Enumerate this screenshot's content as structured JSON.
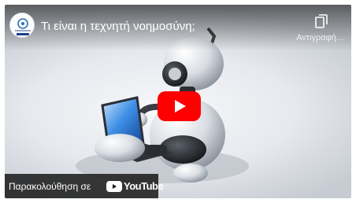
{
  "video": {
    "title": "Τι είναι η τεχνητή νοημοσύνη;",
    "copy_label": "Αντιγραφή…",
    "watch_on_label": "Παρακολούθηση σε",
    "youtube_wordmark": "YouTube"
  },
  "icons": {
    "copy": "copy-icon",
    "play": "play-icon",
    "youtube_logo": "youtube-logo-icon"
  },
  "colors": {
    "play_red": "#ff0000",
    "overlay_dark": "#171717",
    "text_white": "#ffffff"
  }
}
